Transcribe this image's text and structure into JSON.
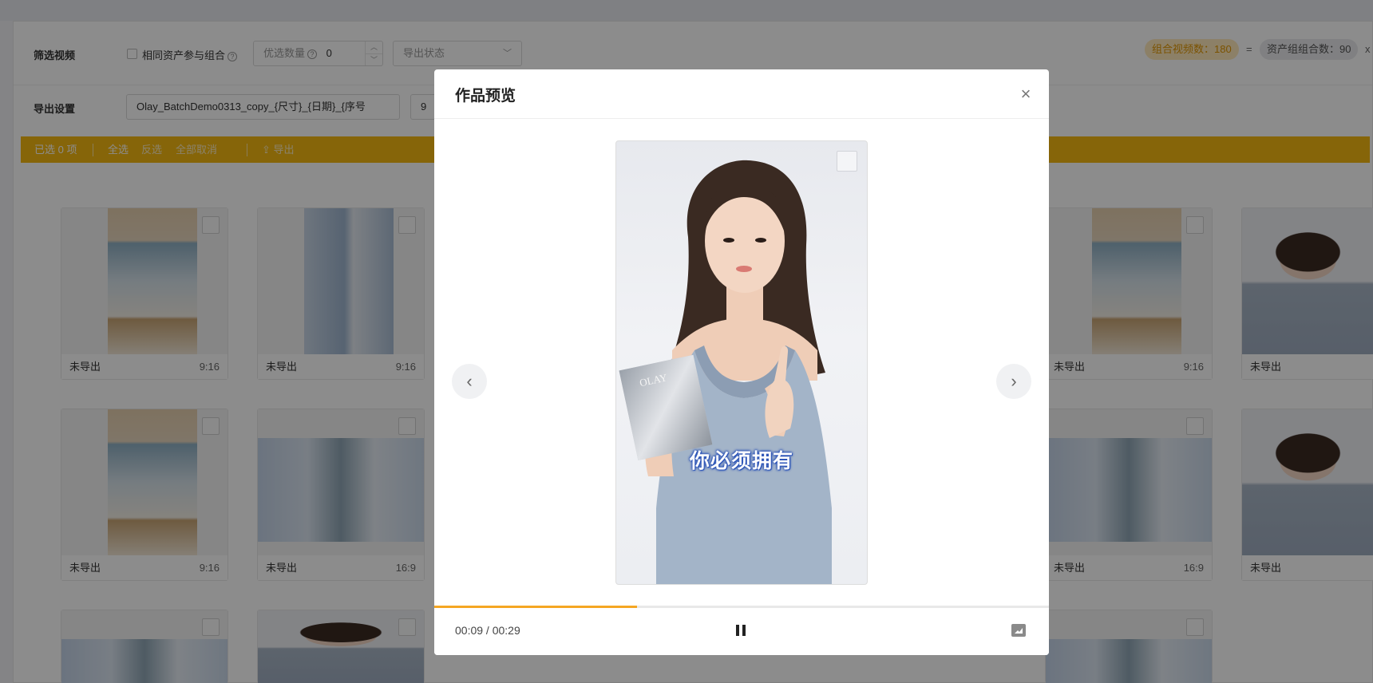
{
  "filter": {
    "label": "筛选视频",
    "same_asset_label": "相同资产参与组合",
    "priority_label": "优选数量",
    "priority_value": "0",
    "export_status_placeholder": "导出状态",
    "combo_count_label": "组合视频数：180",
    "equals": "=",
    "asset_group_label": "资产组组合数：90",
    "times": "x"
  },
  "export": {
    "label": "导出设置",
    "filename_value": "Olay_BatchDemo0313_copy_{尺寸}_{日期}_{序号",
    "second_input_value": "9",
    "tags": [
      "尺寸",
      "日期",
      "序号"
    ]
  },
  "toolbar": {
    "selected": "已选 0 项",
    "select_all": "全选",
    "invert": "反选",
    "cancel_all": "全部取消",
    "export": "导出"
  },
  "video_cards": [
    {
      "status": "未导出",
      "ratio": "9:16"
    },
    {
      "status": "未导出",
      "ratio": "9:16"
    },
    {
      "status": "未导出",
      "ratio": "9:16"
    },
    {
      "status": "未导出",
      "ratio": ""
    },
    {
      "status": "未导出",
      "ratio": "9:16"
    },
    {
      "status": "未导出",
      "ratio": "16:9"
    },
    {
      "status": "未导出",
      "ratio": "16:9"
    },
    {
      "status": "未导出",
      "ratio": ""
    }
  ],
  "modal": {
    "title": "作品预览",
    "close_icon": "close-icon",
    "subtitle": "你必须拥有",
    "time": "00:09 / 00:29",
    "progress": 0.33,
    "prev_icon": "chevron-left-icon",
    "next_icon": "chevron-right-icon",
    "pause_icon": "pause-icon",
    "fullscreen_icon": "fullscreen-icon"
  },
  "colors": {
    "accent": "#f5b912",
    "progress": "#f5a623",
    "subtitle_stroke": "#2c54b8"
  }
}
